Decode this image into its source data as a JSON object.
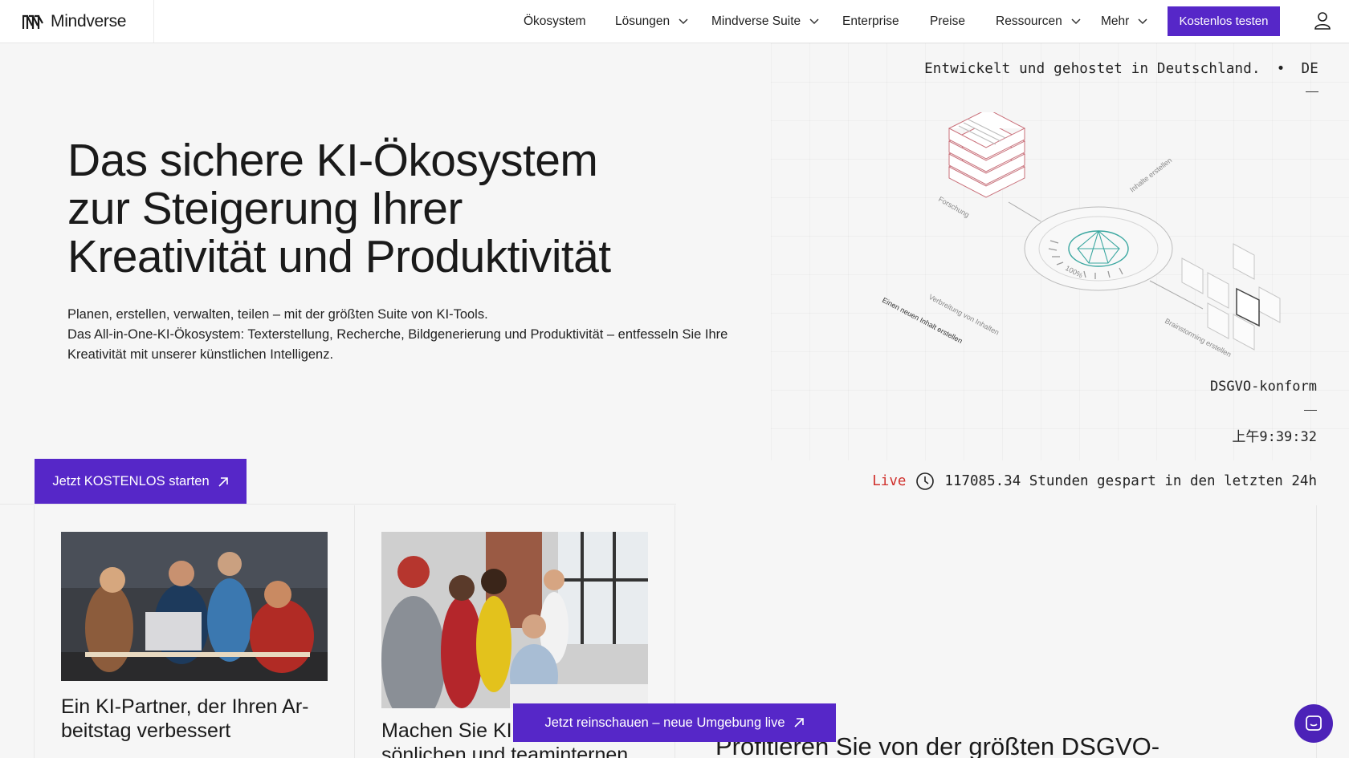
{
  "brand": {
    "name": "Mindverse",
    "accent": "#5627c8"
  },
  "nav": {
    "items": [
      {
        "label": "Ökosystem",
        "has_dropdown": false
      },
      {
        "label": "Lösungen",
        "has_dropdown": true
      },
      {
        "label": "Mindverse Suite",
        "has_dropdown": true
      },
      {
        "label": "Enterprise",
        "has_dropdown": false
      },
      {
        "label": "Preise",
        "has_dropdown": false
      },
      {
        "label": "Ressourcen",
        "has_dropdown": true
      },
      {
        "label": "Mehr",
        "has_dropdown": true
      }
    ],
    "cta_label": "Kostenlos testen",
    "user_icon": "user-icon"
  },
  "hero": {
    "hosted_text": "Entwickelt und gehostet in Deutschland.",
    "bullet": "•",
    "language": "DE",
    "title_lines": [
      "Das sichere KI-Ökosystem",
      "zur Steigerung Ihrer",
      "Kreativität und Produktivität"
    ],
    "desc_line1": "Planen, erstellen, verwalten, teilen – mit der größten Suite von KI-Tools.",
    "desc_line2": "Das All-in-One-KI-Ökosystem: Texterstellung, Recherche, Bildgenerierung und Produktivität – entfesseln Sie Ihre Kreativität mit unserer künstlichen Intelligenz.",
    "illustration_labels": {
      "research": "Forschung",
      "create_content": "Inhalte erstellen",
      "percent": "100%",
      "new_content": "Einen neuen Inhalt erstellen",
      "distribution": "Verbreitung von Inhalten",
      "brainstorming": "Brainstorming erstellen"
    },
    "dsgvo": "DSGVO-konform",
    "clock": "上午9:39:32",
    "cta_label": "Jetzt KOSTENLOS starten",
    "live_label": "Live",
    "live_stat": "117085.34 Stunden gespart in den letzten 24h"
  },
  "cards": [
    {
      "title_line1": "Ein KI-Partner, der Ihren Ar-",
      "title_line2": "beitstag verbessert"
    },
    {
      "title_line1": "Machen Sie KI zu Ihrem per-",
      "title_line2": "sönlichen und teaminternen"
    },
    {
      "title": "Profitieren Sie von der größten DSGVO-"
    }
  ],
  "floating_cta": "Jetzt reinschauen – neue Umgebung live",
  "chat_icon": "chat-icon"
}
